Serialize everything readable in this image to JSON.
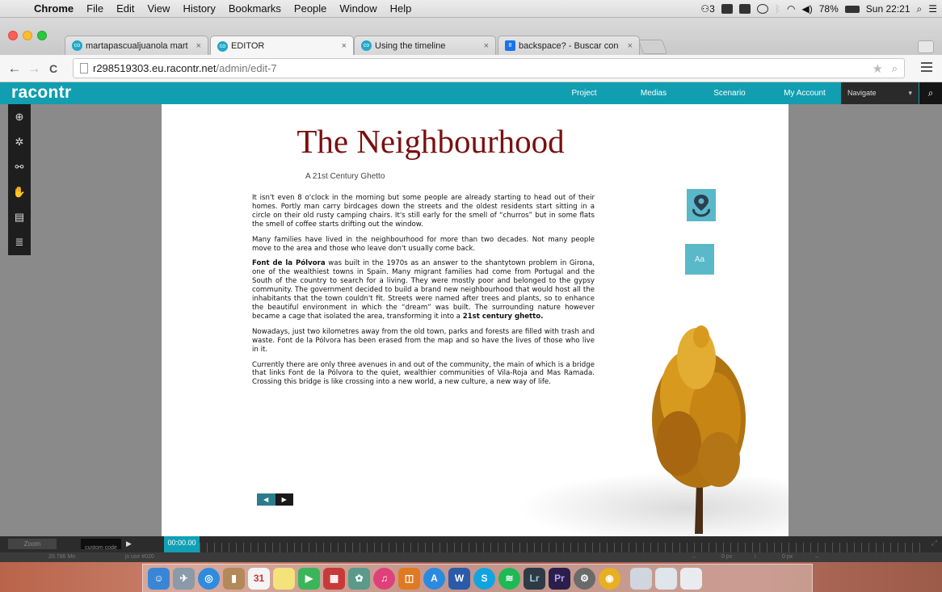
{
  "menubar": {
    "apple": "",
    "app": "Chrome",
    "items": [
      "File",
      "Edit",
      "View",
      "History",
      "Bookmarks",
      "People",
      "Window",
      "Help"
    ],
    "badge": "3",
    "battery": "78%",
    "clock": "Sun 22:21"
  },
  "browser": {
    "tabs": [
      {
        "title": "martapascualjuanola mart",
        "close": "×",
        "active": false
      },
      {
        "title": "EDITOR",
        "close": "×",
        "active": true
      },
      {
        "title": "Using the timeline",
        "close": "×",
        "active": false
      },
      {
        "title": "backspace? - Buscar con",
        "close": "×",
        "active": false
      }
    ],
    "url_host": "r298519303.eu.racontr.net",
    "url_path": "/admin/edit-7",
    "back": "←",
    "forward": "→",
    "reload": "C"
  },
  "racontr": {
    "logo": "racontr",
    "nav": [
      "Project",
      "Medias",
      "Scenario",
      "My Account"
    ],
    "navigate": "Navigate",
    "navigate_caret": "▾",
    "search_icon": "⌕",
    "brand_color": "#119eb0"
  },
  "tools": [
    "plus-circle-icon",
    "gear-icon",
    "link-icon",
    "hand-icon",
    "page-icon",
    "layers-icon"
  ],
  "canvas": {
    "title": "The Neighbourhood",
    "subtitle": "A 21st Century Ghetto",
    "paragraphs": {
      "p1": "It isn't even 8 o'clock in the morning but some people are already starting to head out of their homes. Portly man carry birdcages down the streets and the oldest residents start sitting in a circle on their old rusty camping chairs. It's still early for the smell of “churros” but in some flats the smell of coffee starts drifting out the window.",
      "p2": "Many families have lived in the neighbourhood for more than two decades. Not many people move to the area and those who leave don't usually come back.",
      "p3_bold": "Font de la Pólvora",
      "p3_rest": " was built in the 1970s as an answer to the shantytown problem in Girona, one of the wealthiest towns in Spain. Many migrant families had come from Portugal and the South of the country to search for a living. They were mostly poor and belonged to the gypsy community. The government decided to build a brand new neighbourhood that would host all the inhabitants that the town couldn't fit. Streets were named after trees and plants, so to enhance the beautiful environment in which the “dream” was built. The surrounding nature however became a cage that isolated the area, transforming it into a ",
      "p3_end_bold": "21st century ghetto.",
      "p4": "Nowadays, just two kilometres away from the old town, parks and forests are filled with trash and waste. Font de la Pólvora has been erased from the map and so have the lives of those who live in it.",
      "p5": "Currently there are only three avenues in and out of the community, the main of which is a bridge that links Font de la Pólvora to the quiet, wealthier communities of Vila-Roja and Mas Ramada. Crossing this bridge is like crossing into a new world, a new culture, a new way of life."
    },
    "text_icon_label": "Aa",
    "title_color": "#7a1010"
  },
  "timeline": {
    "zoom": "Zoom",
    "custom": "custom code",
    "play": "▶",
    "timecode": "00:00.00",
    "expand": "⤢",
    "status": [
      "20.786 Mo",
      "js use #020",
      "→",
      "0 px",
      "↕",
      "0 px",
      "↔"
    ]
  },
  "dock": {
    "calendar_day": "31",
    "app_letters": [
      "W",
      "S",
      "Lr",
      "Pr"
    ]
  }
}
